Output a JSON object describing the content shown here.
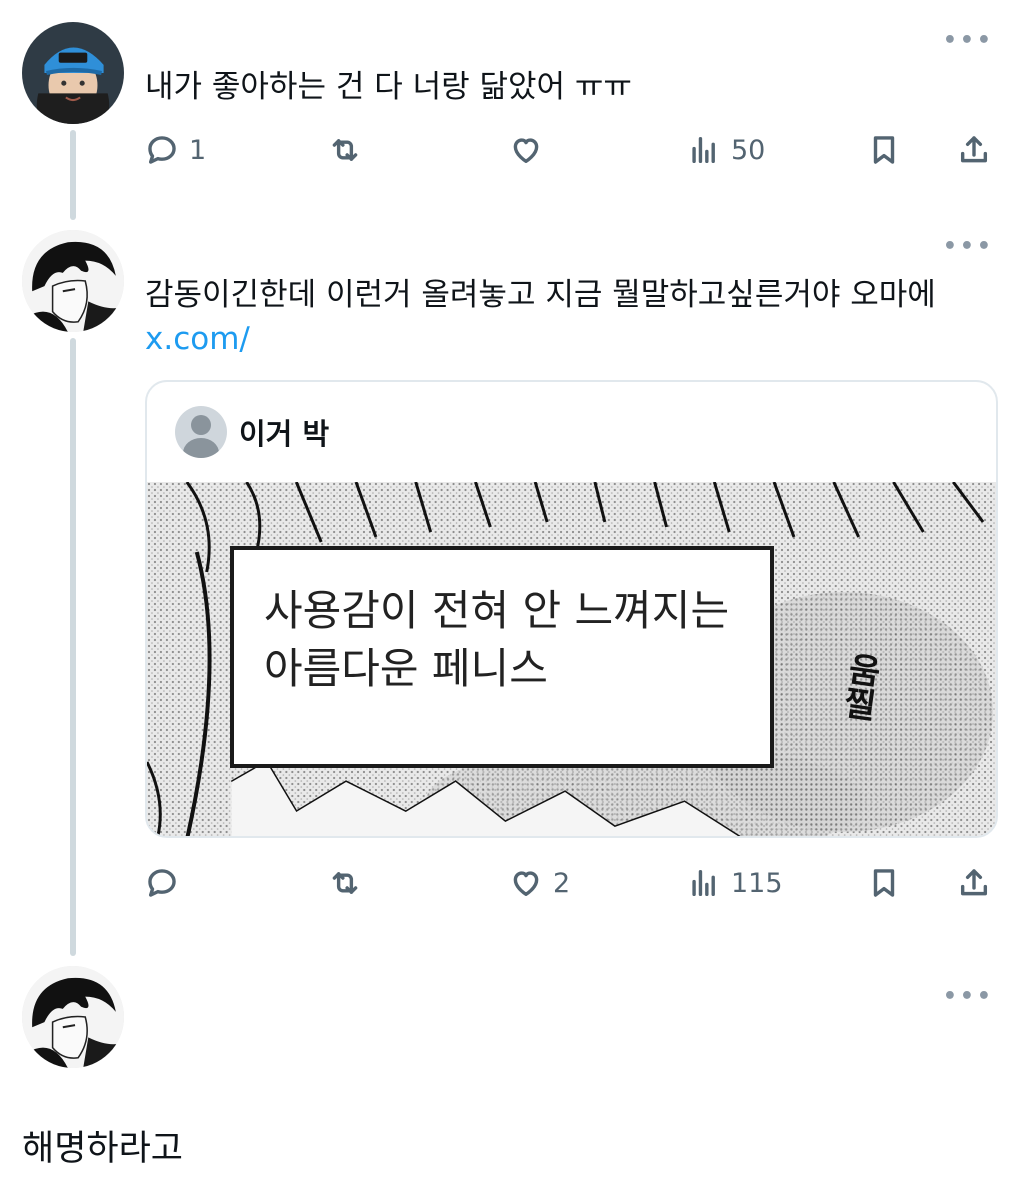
{
  "tweets": [
    {
      "text": "내가 좋아하는 건 다 너랑 닮았어 ㅠㅠ",
      "avatar_icon": "avatar-blue-cap-icon",
      "stats": {
        "replies": "1",
        "reposts": "",
        "likes": "",
        "views": "50"
      }
    },
    {
      "text": "감동이긴한데 이런거 올려놓고 지금 뭘말하고싶른거야 오마에",
      "link": "x.com/",
      "avatar_icon": "avatar-manga-icon",
      "quote": {
        "author_name": "이거 박",
        "image_caption_line1": "사용감이 전혀 안 느껴지는",
        "image_caption_line2": "아름다운 페니스",
        "image_sfx": "움찔"
      },
      "stats": {
        "replies": "",
        "reposts": "",
        "likes": "2",
        "views": "115"
      }
    },
    {
      "text": "해명하라고",
      "avatar_icon": "avatar-manga-icon"
    }
  ],
  "icons": {
    "more": "more-dots-icon",
    "reply": "reply-icon",
    "repost": "repost-icon",
    "like": "heart-icon",
    "views": "views-icon",
    "bookmark": "bookmark-icon",
    "share": "share-icon"
  },
  "colors": {
    "link": "#1d9bf0",
    "icon": "#536471",
    "thread": "#cfd9de"
  },
  "more_label": "•••"
}
